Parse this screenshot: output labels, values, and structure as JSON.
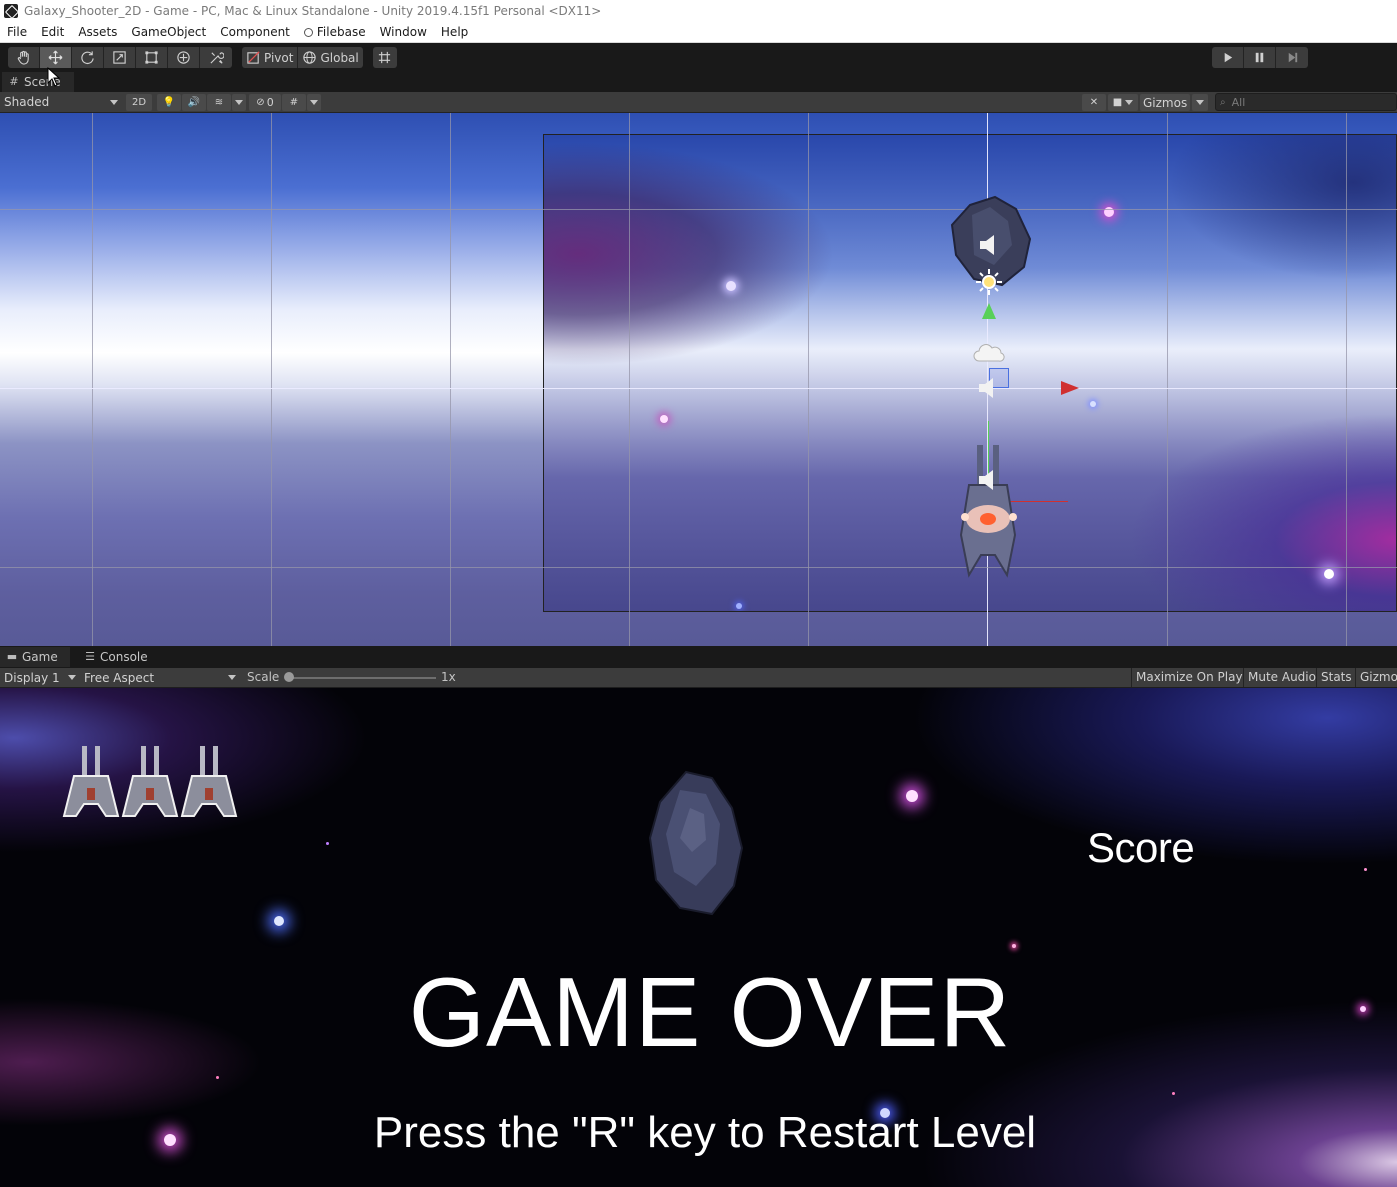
{
  "window": {
    "title": "Galaxy_Shooter_2D - Game - PC, Mac & Linux Standalone - Unity 2019.4.15f1 Personal <DX11>"
  },
  "menu": {
    "items": [
      "File",
      "Edit",
      "Assets",
      "GameObject",
      "Component",
      "Filebase",
      "Window",
      "Help"
    ]
  },
  "toolbar": {
    "tools": [
      "hand-icon",
      "move-icon",
      "rotate-icon",
      "scale-icon",
      "rect-icon",
      "transform-icon",
      "custom-tool-icon"
    ],
    "active_tool": "move-icon",
    "pivot_label": "Pivot",
    "global_label": "Global"
  },
  "scene": {
    "tab_label": "Scene",
    "shading_mode": "Shaded",
    "mode_2d_label": "2D",
    "hidden_count": "0",
    "gizmos_label": "Gizmos",
    "search_placeholder": "All"
  },
  "game": {
    "tab_label": "Game",
    "console_tab_label": "Console",
    "display": "Display 1",
    "aspect": "Free Aspect",
    "scale_label": "Scale",
    "scale_value": "1x",
    "maximize_label": "Maximize On Play",
    "mute_label": "Mute Audio",
    "stats_label": "Stats",
    "gizmos_label": "Gizmos",
    "lives_count": 3,
    "score_label": "Score",
    "game_over_text": "GAME OVER",
    "restart_text": "Press the \"R\" key to Restart Level"
  },
  "colors": {
    "editor_bg": "#191919",
    "toolbar_bg": "#3c3c3c",
    "game_text": "#ffffff",
    "gizmo_x": "#d03030",
    "gizmo_y": "#58d058"
  }
}
